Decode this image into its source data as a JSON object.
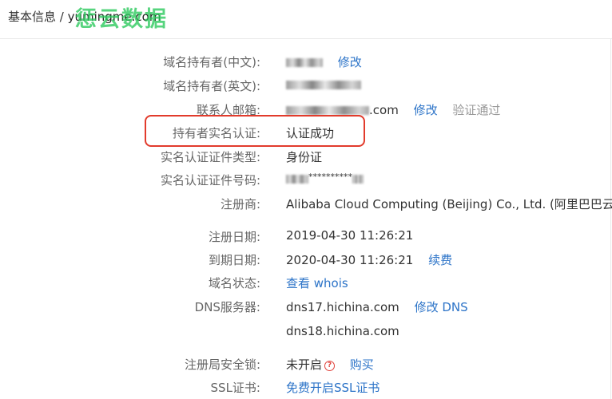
{
  "breadcrumb": {
    "section": "基本信息",
    "separator": " / ",
    "domain": "yumingme.com"
  },
  "watermark": "惩云数据",
  "fields": {
    "owner_cn": {
      "label": "域名持有者(中文):",
      "action": "修改"
    },
    "owner_en": {
      "label": "域名持有者(英文):"
    },
    "email": {
      "label": "联系人邮箱:",
      "suffix": ".com",
      "action": "修改",
      "status": "验证通过"
    },
    "realname": {
      "label": "持有者实名认证:",
      "value": "认证成功"
    },
    "cert_type": {
      "label": "实名认证证件类型:",
      "value": "身份证"
    },
    "cert_no": {
      "label": "实名认证证件号码:",
      "masked": "**********"
    },
    "registrar": {
      "label": "注册商:",
      "value": "Alibaba Cloud Computing (Beijing) Co., Ltd. (阿里巴巴云计算"
    },
    "reg_date": {
      "label": "注册日期:",
      "value": "2019-04-30 11:26:21"
    },
    "exp_date": {
      "label": "到期日期:",
      "value": "2020-04-30 11:26:21",
      "action": "续费"
    },
    "status": {
      "label": "域名状态:",
      "action": "查看 whois"
    },
    "dns": {
      "label": "DNS服务器:",
      "value1": "dns17.hichina.com",
      "action": "修改 DNS",
      "value2": "dns18.hichina.com"
    },
    "lock": {
      "label": "注册局安全锁:",
      "value": "未开启",
      "help_icon": "?",
      "action": "购买"
    },
    "ssl": {
      "label": "SSL证书:",
      "action": "免费开启SSL证书"
    }
  },
  "colors": {
    "link": "#2d74c8",
    "highlight_border": "#e23b2c",
    "watermark": "#28c85a"
  }
}
